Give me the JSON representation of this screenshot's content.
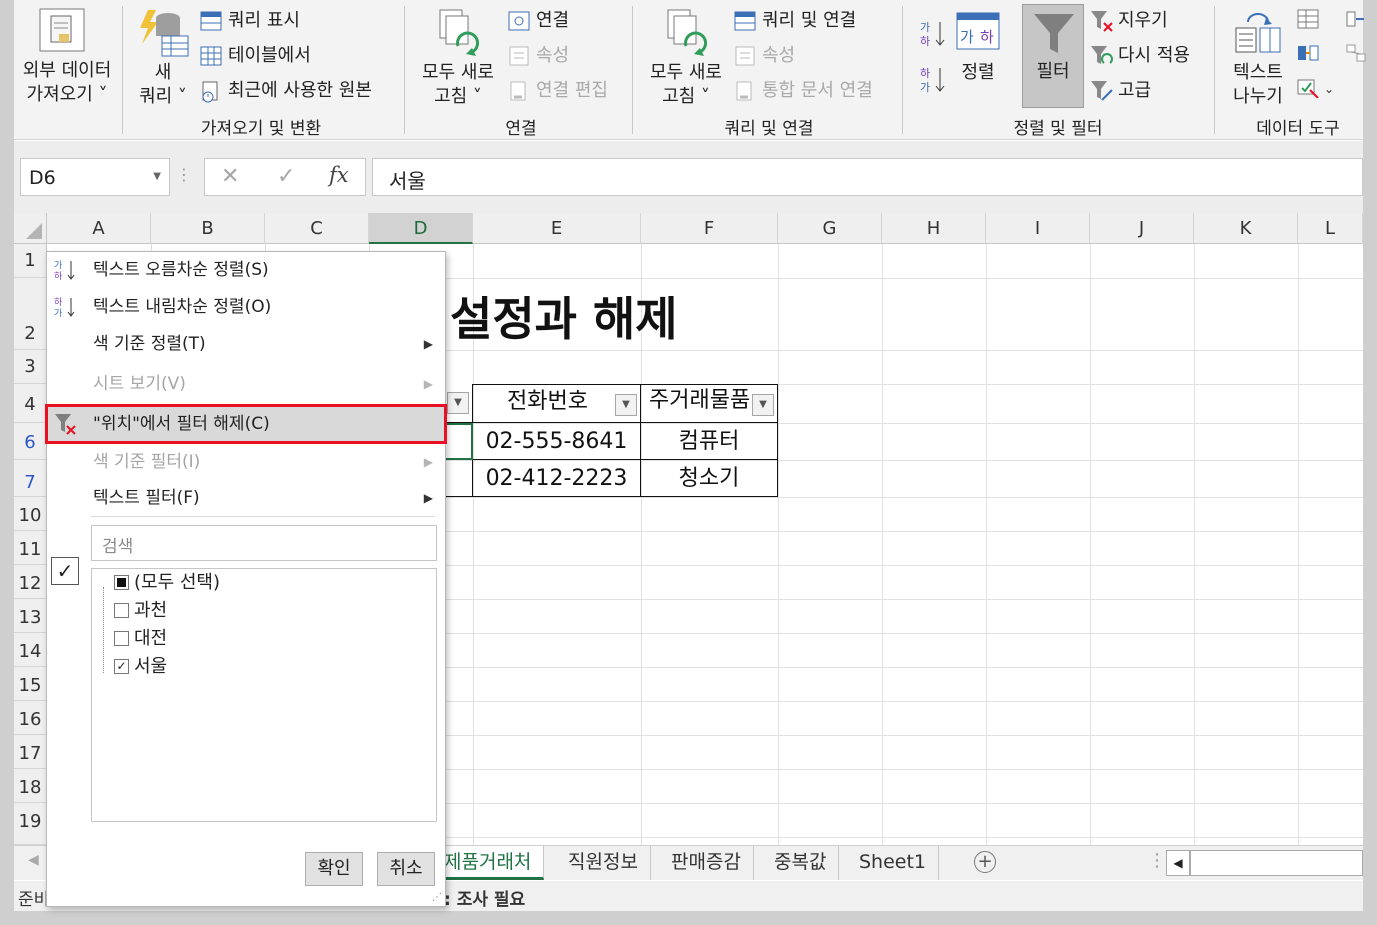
{
  "ribbon": {
    "get_external": {
      "line1": "외부 데이터",
      "line2": "가져오기 ˅"
    },
    "new_query": {
      "line1": "새",
      "line2": "쿼리 ˅"
    },
    "show_queries": "쿼리 표시",
    "from_table": "테이블에서",
    "recent_sources": "최근에 사용한 원본",
    "group_get_transform": "가져오기 및 변환",
    "refresh_all_1": {
      "line1": "모두 새로",
      "line2": "고침 ˅"
    },
    "connections": "연결",
    "properties_1": "속성",
    "edit_links": "연결 편집",
    "group_connections": "연결",
    "refresh_all_2": {
      "line1": "모두 새로",
      "line2": "고침 ˅"
    },
    "queries_connections": "쿼리 및 연결",
    "properties_2": "속성",
    "workbook_links": "통합 문서 연결",
    "group_queries_connections": "쿼리 및 연결",
    "sort": "정렬",
    "filter": "필터",
    "clear": "지우기",
    "reapply": "다시 적용",
    "advanced": "고급",
    "group_sort_filter": "정렬 및 필터",
    "text_to_columns": {
      "line1": "텍스트",
      "line2": "나누기"
    },
    "group_data_tools": "데이터 도구"
  },
  "formula_bar": {
    "name_box": "D6",
    "value": "서울"
  },
  "columns": [
    "A",
    "B",
    "C",
    "D",
    "E",
    "F",
    "G",
    "H",
    "I",
    "J",
    "K",
    "L"
  ],
  "rows": [
    "1",
    "2",
    "3",
    "4",
    "6",
    "7",
    "10",
    "11",
    "12",
    "13",
    "14",
    "15",
    "16",
    "17",
    "18",
    "19"
  ],
  "sheet": {
    "title": "설정과 해제",
    "headers": {
      "e": "전화번호",
      "f": "주거래물품"
    },
    "row6": {
      "e": "02-555-8641",
      "f": "컴퓨터"
    },
    "row7": {
      "e": "02-412-2223",
      "f": "청소기"
    }
  },
  "tabs": [
    "제품거래처",
    "직원정보",
    "판매증감",
    "중복값",
    "Sheet1"
  ],
  "status": {
    "ready": "준비",
    "note": ": 조사 필요"
  },
  "menu": {
    "sort_asc": "텍스트 오름차순 정렬(S)",
    "sort_desc": "텍스트 내림차순 정렬(O)",
    "sort_color": "색 기준 정렬(T)",
    "sheet_view": "시트 보기(V)",
    "clear_filter": "\"위치\"에서 필터 해제(C)",
    "filter_color": "색 기준 필터(I)",
    "text_filter": "텍스트 필터(F)",
    "search_placeholder": "검색",
    "items": [
      {
        "label": "(모두 선택)",
        "state": "partial"
      },
      {
        "label": "과천",
        "state": "unchecked"
      },
      {
        "label": "대전",
        "state": "unchecked"
      },
      {
        "label": "서울",
        "state": "checked"
      }
    ],
    "ok": "확인",
    "cancel": "취소"
  },
  "colors": {
    "accent": "#217346",
    "highlight": "#e81123",
    "link_blue": "#2c56c8"
  }
}
